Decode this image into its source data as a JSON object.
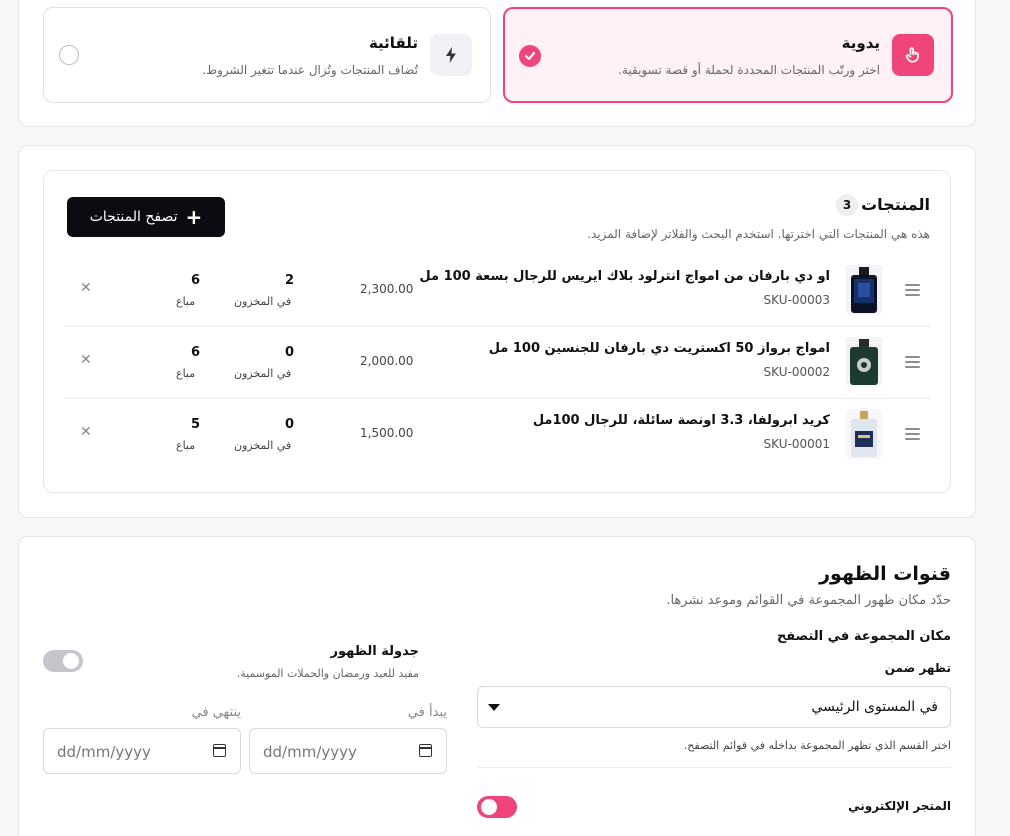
{
  "collection_type": {
    "manual": {
      "title": "يدوية",
      "description": "اختر ورتّب المنتجات المحددة لحملة أو قصة تسويقية.",
      "selected": true,
      "icon": "hand-pointer-icon"
    },
    "automatic": {
      "title": "تلقائية",
      "description": "تُضاف المنتجات وتُزال عندما تتغير الشروط.",
      "selected": false,
      "icon": "lightning-icon"
    }
  },
  "products": {
    "title": "المنتجات",
    "count": "3",
    "subtitle": "هذه هي المنتجات التي اخترتها. استخدم البحث والفلاتر لإضافة المزيد.",
    "browse_label": "تصفح المنتجات",
    "stock_label": "في المخزون",
    "sold_label": "مباع",
    "items": [
      {
        "name": "او دي بارفان من امواج انترلود بلاك ايريس للرجال بسعة 100 مل",
        "sku": "SKU-00003",
        "price": "2,300.00",
        "stock": "2",
        "sold": "6"
      },
      {
        "name": "امواج برواز 50 اكستريت دي بارفان للجنسين 100 مل",
        "sku": "SKU-00002",
        "price": "2,000.00",
        "stock": "0",
        "sold": "6"
      },
      {
        "name": "كريد ابرولفا، 3.3 اونصة سائلة، للرجال 100مل",
        "sku": "SKU-00001",
        "price": "1,500.00",
        "stock": "0",
        "sold": "5"
      }
    ]
  },
  "visibility": {
    "title": "قنوات الظهور",
    "subtitle": "حدّد مكان ظهور المجموعة في القوائم وموعد نشرها.",
    "browse_location_label": "مكان المجموعة في التصفح",
    "appear_in_label": "تظهر ضمن",
    "appear_in_value": "في المستوى الرئيسي",
    "appear_in_help": "اختر القسم الذي تظهر المجموعة بداخله في قوائم التصفح.",
    "online_store_label": "المتجر الإلكتروني",
    "schedule_title": "جدولة الظهور",
    "schedule_subtitle": "مفيد للعيد ورمضان والحملات الموسمية.",
    "start_label": "يبدأ في",
    "end_label": "ينتهي في",
    "date_placeholder": "dd/mm/yyyy"
  },
  "colors": {
    "accent": "#f0457a",
    "dark": "#0b0b12",
    "border": "#e6e6ea"
  }
}
